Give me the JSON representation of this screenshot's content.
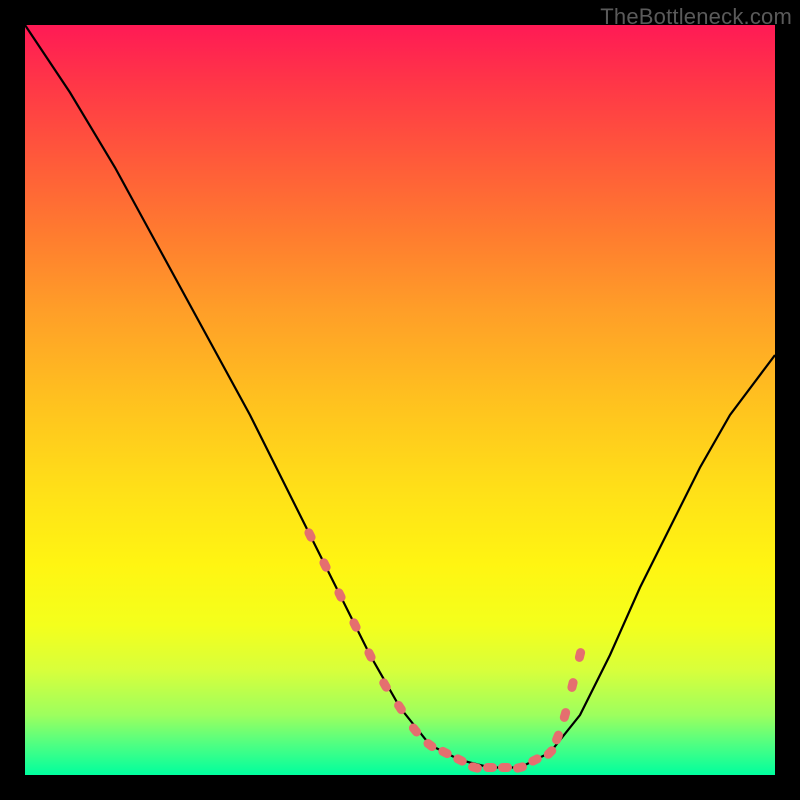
{
  "watermark": "TheBottleneck.com",
  "colors": {
    "background": "#000000",
    "curve_stroke": "#000000",
    "marker_fill": "#e56f6f",
    "gradient_top": "#ff1a55",
    "gradient_bottom": "#00ff9e"
  },
  "chart_data": {
    "type": "line",
    "title": "",
    "xlabel": "",
    "ylabel": "",
    "xlim": [
      0,
      100
    ],
    "ylim": [
      0,
      100
    ],
    "grid": false,
    "series": [
      {
        "name": "curve",
        "x": [
          0,
          6,
          12,
          18,
          24,
          30,
          34,
          38,
          42,
          46,
          50,
          54,
          58,
          62,
          66,
          70,
          74,
          78,
          82,
          86,
          90,
          94,
          100
        ],
        "y": [
          100,
          91,
          81,
          70,
          59,
          48,
          40,
          32,
          24,
          16,
          9,
          4,
          2,
          1,
          1,
          3,
          8,
          16,
          25,
          33,
          41,
          48,
          56
        ]
      }
    ],
    "markers": {
      "name": "highlight-dots",
      "x": [
        38,
        40,
        42,
        44,
        46,
        48,
        50,
        52,
        54,
        56,
        58,
        60,
        62,
        64,
        66,
        68,
        70,
        71,
        72,
        73,
        74
      ],
      "y": [
        32,
        28,
        24,
        20,
        16,
        12,
        9,
        6,
        4,
        3,
        2,
        1,
        1,
        1,
        1,
        2,
        3,
        5,
        8,
        12,
        16
      ]
    }
  }
}
